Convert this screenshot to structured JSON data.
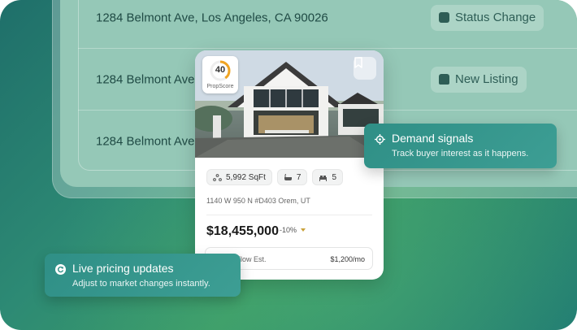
{
  "listings": [
    {
      "address": "1284 Belmont Ave, Los Angeles, CA 90026",
      "tag": "Status Change",
      "tag_icon": "document-icon"
    },
    {
      "address": "1284 Belmont Ave, L",
      "tag": "New Listing",
      "tag_icon": "home-icon"
    },
    {
      "address": "1284 Belmont Ave, L",
      "tag": "",
      "tag_icon": ""
    }
  ],
  "card": {
    "score": "40",
    "score_label": "PropScore",
    "score_fraction": 0.4,
    "score_color": "#f0a422",
    "sqft": "5,992 SqFt",
    "baths": "7",
    "beds": "5",
    "address": "1140 W 950 N #D403 Orem, UT",
    "price": "$18,455,000",
    "change": "-10%",
    "cashflow_label": "p Flow Est.",
    "cashflow_value": "$1,200/mo"
  },
  "demand": {
    "title": "Demand signals",
    "subtitle": "Track buyer interest as it happens."
  },
  "live": {
    "title": "Live pricing updates",
    "subtitle": "Adjust to market changes instantly."
  },
  "colors": {
    "accent": "#3a9a8f",
    "score_orange": "#f0a422"
  }
}
